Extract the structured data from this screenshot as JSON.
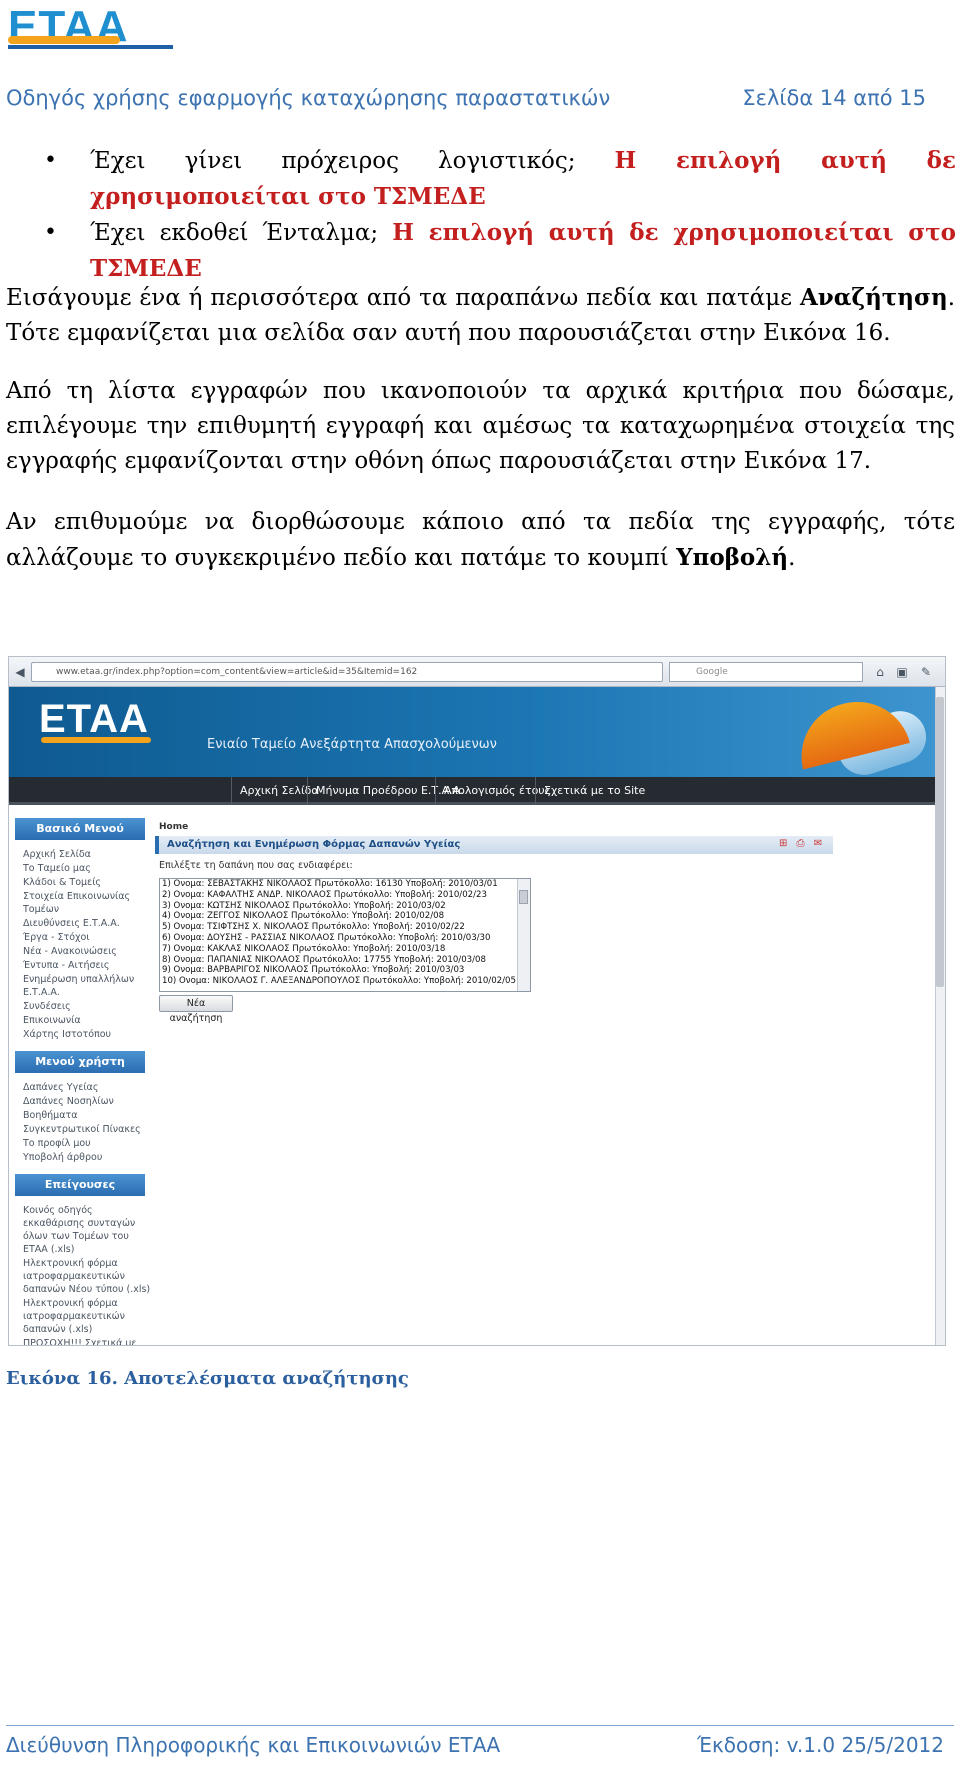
{
  "logo": {
    "text": "ΕΤΑΑ"
  },
  "header": {
    "title": "Οδηγός χρήσης εφαρμογής καταχώρησης παραστατικών",
    "page": "Σελίδα 14 από 15"
  },
  "bullets": [
    {
      "text": "Έχει γίνει πρόχειρος λογιστικός; ",
      "note": "Η επιλογή αυτή δε χρησιμοποιείται στο ΤΣΜΕΔΕ"
    },
    {
      "text": "Έχει εκδοθεί Ένταλμα; ",
      "note": "Η επιλογή αυτή δε χρησιμοποιείται στο ΤΣΜΕΔΕ"
    }
  ],
  "paragraphs": {
    "p1": {
      "a": "Εισάγουμε ένα ή περισσότερα από τα παραπάνω πεδία και πατάμε ",
      "bold": "Αναζήτηση",
      "b": ". Τότε εμφανίζεται μια σελίδα σαν αυτή που παρουσιάζεται στην Εικόνα 16."
    },
    "p2": "Από τη λίστα εγγραφών που ικανοποιούν τα αρχικά κριτήρια που δώσαμε, επιλέγουμε την επιθυμητή εγγραφή και αμέσως τα καταχωρημένα στοιχεία της εγγραφής εμφανίζονται στην οθόνη όπως παρουσιάζεται στην Εικόνα 17.",
    "p3": {
      "a": "Αν επιθυμούμε να διορθώσουμε κάποιο από τα πεδία της εγγραφής, τότε αλλάζουμε το συγκεκριμένο πεδίο και πατάμε το κουμπί ",
      "bold": "Υποβολή",
      "b": "."
    }
  },
  "screenshot": {
    "url": "www.etaa.gr/index.php?option=com_content&view=article&id=35&Itemid=162",
    "search_placeholder": "Google",
    "banner_logo": "ΕΤΑΑ",
    "banner_tagline": "Ενιαίο Ταμείο Ανεξάρτητα Απασχολούμενων",
    "nav": [
      "Αρχική Σελίδα",
      "Μήνυμα Προέδρου Ε.Τ.Α.Α.",
      "Απολογισμός έτους",
      "Σχετικά με το Site"
    ],
    "menu1_title": "Βασικό Μενού",
    "menu1": [
      "Αρχική Σελίδα",
      "Το Ταμείο μας",
      "Κλάδοι & Τομείς",
      "Στοιχεία Επικοινωνίας Τομέων",
      "Διευθύνσεις Ε.Τ.Α.Α.",
      "Έργα - Στόχοι",
      "Νέα - Ανακοινώσεις",
      "Έντυπα - Αιτήσεις",
      "Ενημέρωση υπαλλήλων Ε.Τ.Α.Α.",
      "Συνδέσεις",
      "Επικοινωνία",
      "Χάρτης Ιστοτόπου"
    ],
    "menu2_title": "Μενού χρήστη",
    "menu2": [
      "Δαπάνες Υγείας",
      "Δαπάνες Νοσηλίων",
      "Βοηθήματα",
      "Συγκεντρωτικοί Πίνακες",
      "Το προφίλ μου",
      "Υποβολή άρθρου"
    ],
    "menu3_title": "Επείγουσες Ανακοινώσεις",
    "menu3": [
      "Κοινός οδηγός εκκαθάρισης συνταγών όλων των Τομέων του ΕΤΑΑ (.xls)",
      "Ηλεκτρονική φόρμα ιατροφαρμακευτικών δαπανών Νέου τύπου (.xls)",
      "Ηλεκτρονική φόρμα ιατροφαρμακευτικών δαπανών (.xls)",
      "ΠΡΟΣΟΧΗ!!! Σχετικά με"
    ],
    "breadcrumb": "Home",
    "content_title": "Αναζήτηση και Ενημέρωση Φόρμας Δαπανών Υγείας",
    "content_icons": "⊞ ⎙ ✉",
    "prompt": "Επιλέξτε τη δαπάνη που σας ενδιαφέρει:",
    "results": [
      "1) Ονομα: ΣΕΒΑΣΤΑΚΗΣ ΝΙΚΟΛΑΟΣ Πρωτόκολλο: 16130 Υποβολή: 2010/03/01",
      "2) Ονομα: ΚΑΦΑΛΤΗΣ ΑΝΔΡ. ΝΙΚΟΛΑΟΣ Πρωτόκολλο: Υποβολή: 2010/02/23",
      "3) Ονομα: ΚΩΤΣΗΣ ΝΙΚΟΛΑΟΣ Πρωτόκολλο: Υποβολή: 2010/03/02",
      "4) Ονομα: ΖΕΓΓΟΣ ΝΙΚΟΛΑΟΣ Πρωτόκολλο: Υποβολή: 2010/02/08",
      "5) Ονομα: ΤΣΙΦΤΣΗΣ Χ. ΝΙΚΟΛΑΟΣ Πρωτόκολλο: Υποβολή: 2010/02/22",
      "6) Ονομα: ΔΟΥΣΗΣ - ΡΑΣΣΙΑΣ ΝΙΚΟΛΑΟΣ Πρωτόκολλο: Υποβολή: 2010/03/30",
      "7) Ονομα: ΚΑΚΛΑΣ ΝΙΚΟΛΑΟΣ Πρωτόκολλο: Υποβολή: 2010/03/18",
      "8) Ονομα: ΠΑΠΑΝΙΑΣ ΝΙΚΟΛΑΟΣ Πρωτόκολλο: 17755 Υποβολή: 2010/03/08",
      "9) Ονομα: ΒΑΡΒΑΡΙΓΟΣ ΝΙΚΟΛΑΟΣ Πρωτόκολλο: Υποβολή: 2010/03/03",
      "10) Ονομα: ΝΙΚΟΛΑΟΣ Γ. ΑΛΕΞΑΝΔΡΟΠΟΥΛΟΣ Πρωτόκολλο: Υποβολή: 2010/02/05"
    ],
    "new_search_button": "Νέα αναζήτηση"
  },
  "caption": "Εικόνα 16. Αποτελέσματα αναζήτησης",
  "footer": {
    "left": "Διεύθυνση Πληροφορικής και Επικοινωνιών ΕΤΑΑ",
    "right": "Έκδοση: v.1.0 25/5/2012"
  }
}
